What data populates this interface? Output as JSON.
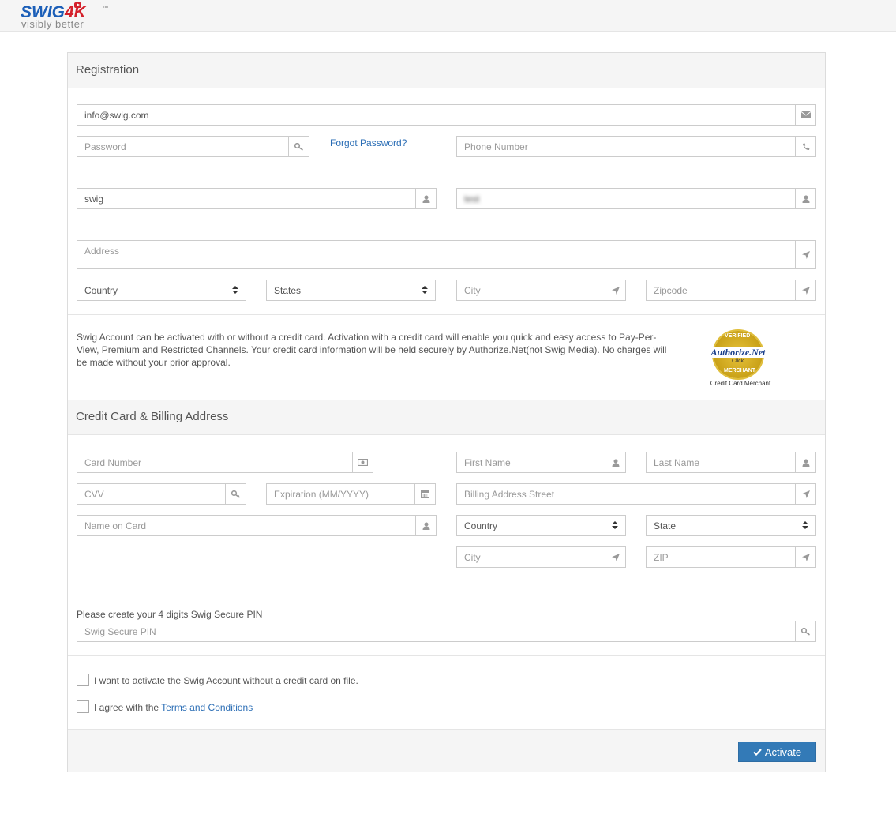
{
  "brand": {
    "name_part1": "SWIG",
    "name_part2": "4K",
    "tm": "™",
    "tagline": "visibly better"
  },
  "registration": {
    "heading": "Registration",
    "email": {
      "value": "info@swig.com",
      "icon": "envelope-icon"
    },
    "password": {
      "placeholder": "Password",
      "icon": "key-icon"
    },
    "forgot_password": "Forgot Password?",
    "phone": {
      "placeholder": "Phone Number",
      "icon": "phone-icon"
    },
    "first_name": {
      "value": "swig",
      "icon": "user-icon"
    },
    "last_name": {
      "value": "test",
      "icon": "user-icon"
    },
    "address": {
      "placeholder": "Address",
      "icon": "location-arrow-icon"
    },
    "country": {
      "selected": "Country"
    },
    "states": {
      "selected": "States"
    },
    "city": {
      "placeholder": "City",
      "icon": "location-arrow-icon"
    },
    "zipcode": {
      "placeholder": "Zipcode",
      "icon": "location-arrow-icon"
    }
  },
  "notice": {
    "text": "Swig Account can be activated with or without a credit card. Activation with a credit card will enable you quick and easy access to Pay-Per-View, Premium and Restricted Channels. Your credit card information will be held securely by Authorize.Net(not Swig Media). No charges will be made without your prior approval.",
    "seal": {
      "top": "VERIFIED",
      "brand": "Authorize.Net",
      "click": "Click",
      "bottom": "MERCHANT",
      "caption": "Credit Card Merchant"
    }
  },
  "billing": {
    "heading": "Credit Card & Billing Address",
    "card_number": {
      "placeholder": "Card Number",
      "icon": "money-icon"
    },
    "first_name": {
      "placeholder": "First Name",
      "icon": "user-icon"
    },
    "last_name": {
      "placeholder": "Last Name",
      "icon": "user-icon"
    },
    "cvv": {
      "placeholder": "CVV",
      "icon": "key-icon"
    },
    "expiration": {
      "placeholder": "Expiration (MM/YYYY)",
      "icon": "calendar-icon"
    },
    "street": {
      "placeholder": "Billing Address Street",
      "icon": "location-arrow-icon"
    },
    "name_on_card": {
      "placeholder": "Name on Card",
      "icon": "user-icon"
    },
    "country": {
      "selected": "Country"
    },
    "state": {
      "selected": "State"
    },
    "city": {
      "placeholder": "City",
      "icon": "location-arrow-icon"
    },
    "zip": {
      "placeholder": "ZIP",
      "icon": "location-arrow-icon"
    }
  },
  "pin": {
    "label": "Please create your 4 digits Swig Secure PIN",
    "placeholder": "Swig Secure PIN",
    "icon": "key-icon"
  },
  "checkboxes": {
    "no_card": {
      "label": "I want to activate the Swig Account without a credit card on file.",
      "checked": false
    },
    "terms": {
      "label_prefix": "I agree with the ",
      "link": "Terms and Conditions",
      "checked": false
    }
  },
  "actions": {
    "activate": "Activate"
  },
  "colors": {
    "primary": "#337ab7",
    "link": "#2a6db5",
    "brand_blue": "#1c5fb8",
    "brand_red": "#d4202a"
  }
}
